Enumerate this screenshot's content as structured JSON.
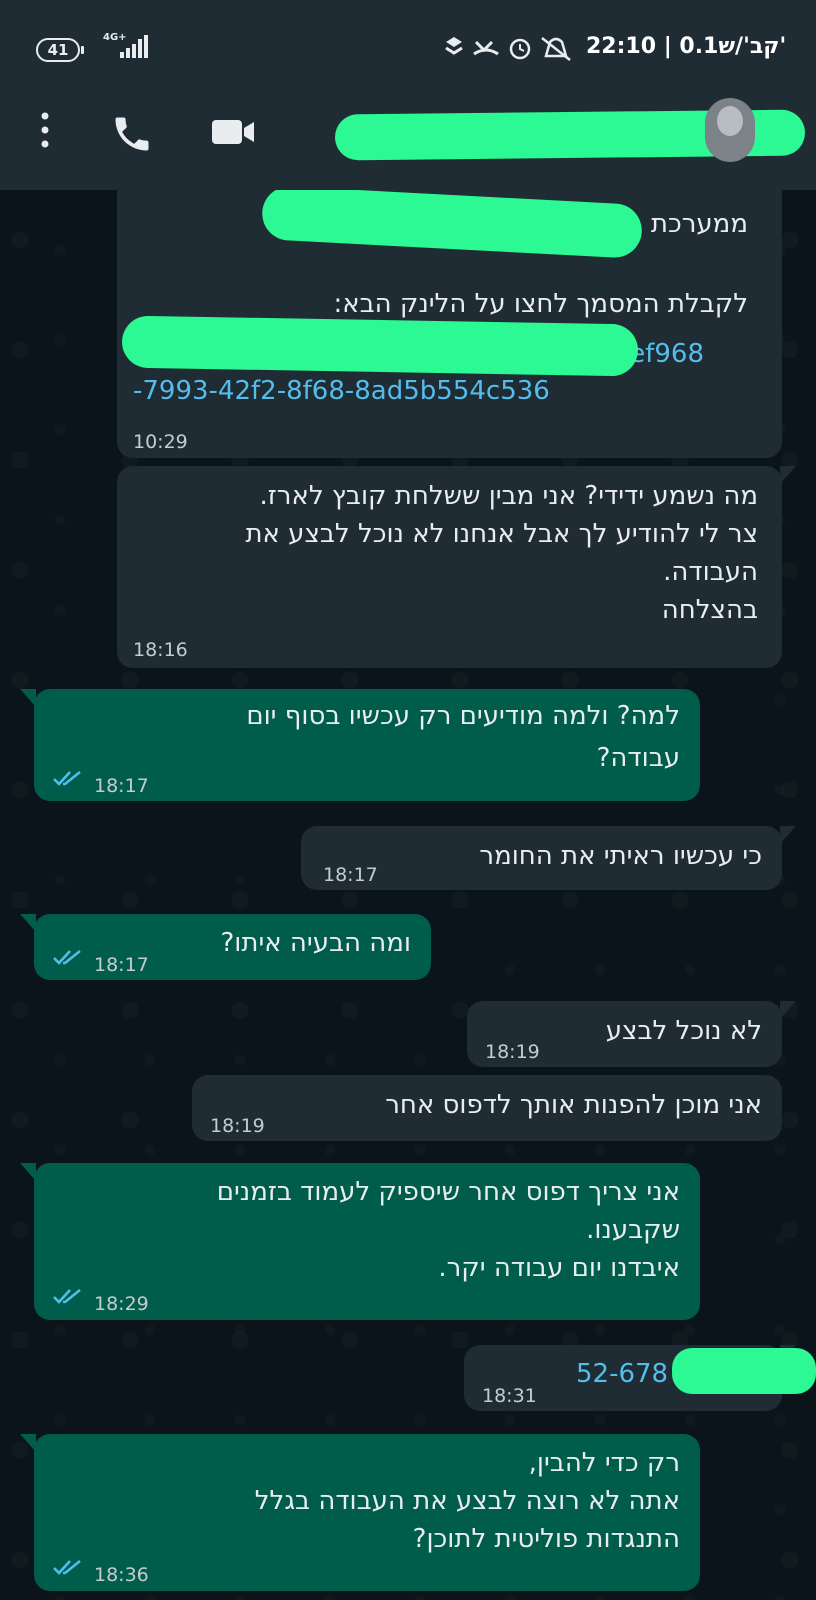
{
  "status_bar": {
    "battery": "41",
    "network": "4G+",
    "text": "22:10 | 0.1קב'/ש'"
  },
  "header": {
    "menu_icon": "more-vert-icon",
    "call_icon": "phone-icon",
    "video_icon": "videocam-icon",
    "avatar": "contact-avatar"
  },
  "colors": {
    "chat_bg": "#0b141a",
    "header_bg": "#1f2c34",
    "incoming_bubble": "#1f2c34",
    "outgoing_bubble": "#005c4b",
    "link": "#53bdeb",
    "read_ticks": "#53bdeb",
    "redaction": "#2cf894"
  },
  "messages": [
    {
      "direction": "incoming",
      "line1": "ממערכת",
      "line2": "לקבלת המסמך לחצו על הלינק הבא:",
      "link1": "ef968",
      "link2": "-7993-42f2-8f68-8ad5b554c536",
      "time": "10:29"
    },
    {
      "direction": "incoming",
      "lines": [
        "מה נשמע ידידי? אני מבין ששלחת קובץ לארז.",
        "צר לי להודיע לך אבל אנחנו לא נוכל לבצע את",
        "העבודה.",
        "בהצלחה"
      ],
      "time": "18:16"
    },
    {
      "direction": "outgoing",
      "lines": [
        "למה? ולמה מודיעים רק עכשיו בסוף יום",
        "עבודה?"
      ],
      "time": "18:17",
      "status": "read"
    },
    {
      "direction": "incoming",
      "lines": [
        "כי עכשיו ראיתי את החומר"
      ],
      "time": "18:17"
    },
    {
      "direction": "outgoing",
      "lines": [
        "ומה הבעיה איתו?"
      ],
      "time": "18:17",
      "status": "read"
    },
    {
      "direction": "incoming",
      "lines": [
        "לא נוכל לבצע"
      ],
      "time": "18:19"
    },
    {
      "direction": "incoming",
      "lines": [
        "אני מוכן להפנות אותך לדפוס אחר"
      ],
      "time": "18:19"
    },
    {
      "direction": "outgoing",
      "lines": [
        "אני צריך דפוס אחר שיספיק לעמוד בזמנים",
        "שקבענו.",
        "איבדנו יום עבודה יקר."
      ],
      "time": "18:29",
      "status": "read"
    },
    {
      "direction": "incoming",
      "lines": [
        "52-678"
      ],
      "time": "18:31"
    },
    {
      "direction": "outgoing",
      "lines": [
        "רק כדי להבין,",
        "אתה לא רוצה לבצע את העבודה בגלל",
        "התנגדות פוליטית לתוכן?"
      ],
      "time": "18:36",
      "status": "read"
    }
  ]
}
